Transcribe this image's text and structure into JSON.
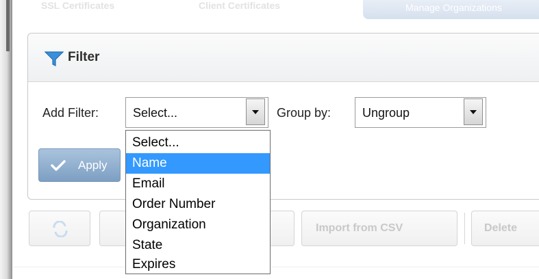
{
  "top_tabs": [
    "SSL Certificates",
    "Client Certificates"
  ],
  "top_pill_label": "Manage Organizations",
  "filter": {
    "title": "Filter",
    "add_filter_label": "Add Filter:",
    "add_filter_value": "Select...",
    "group_by_label": "Group by:",
    "group_by_value": "Ungroup",
    "apply_label": "Apply",
    "options": [
      "Select...",
      "Name",
      "Email",
      "Order Number",
      "Organization",
      "State",
      "Expires"
    ],
    "selected_option": "Name"
  },
  "toolbar": {
    "import_label": "Import from CSV",
    "delete_label": "Delete"
  },
  "colors": {
    "selection": "#3399ff",
    "apply_button": "#7d9fc3",
    "funnel": "#3a8fd9"
  }
}
